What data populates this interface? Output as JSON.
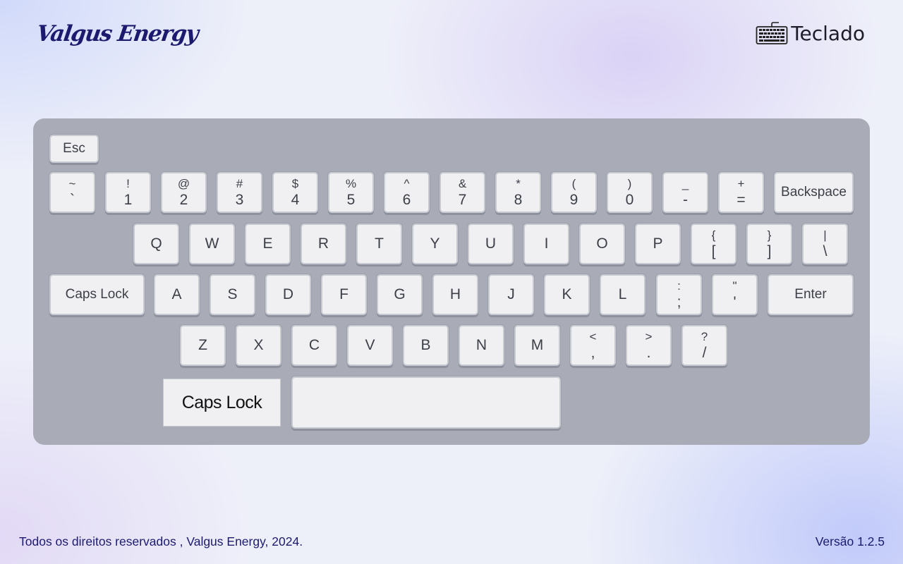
{
  "brand": "Valgus Energy",
  "app_title": "Teclado",
  "icons": {
    "app": "keyboard-icon"
  },
  "keyboard": {
    "esc": "Esc",
    "number_row": [
      {
        "top": "~",
        "bottom": "`"
      },
      {
        "top": "!",
        "bottom": "1"
      },
      {
        "top": "@",
        "bottom": "2"
      },
      {
        "top": "#",
        "bottom": "3"
      },
      {
        "top": "$",
        "bottom": "4"
      },
      {
        "top": "%",
        "bottom": "5"
      },
      {
        "top": "^",
        "bottom": "6"
      },
      {
        "top": "&",
        "bottom": "7"
      },
      {
        "top": "*",
        "bottom": "8"
      },
      {
        "top": "(",
        "bottom": "9"
      },
      {
        "top": ")",
        "bottom": "0"
      },
      {
        "top": "_",
        "bottom": "-"
      },
      {
        "top": "+",
        "bottom": "="
      }
    ],
    "backspace": "Backspace",
    "qwerty_row": [
      "Q",
      "W",
      "E",
      "R",
      "T",
      "Y",
      "U",
      "I",
      "O",
      "P"
    ],
    "qwerty_extra": [
      {
        "top": "{",
        "bottom": "["
      },
      {
        "top": "}",
        "bottom": "]"
      },
      {
        "top": "|",
        "bottom": "\\"
      }
    ],
    "caps_lock": "Caps Lock",
    "home_row": [
      "A",
      "S",
      "D",
      "F",
      "G",
      "H",
      "J",
      "K",
      "L"
    ],
    "home_extra": [
      {
        "top": ":",
        "bottom": ";"
      },
      {
        "top": "\"",
        "bottom": "'"
      }
    ],
    "enter": "Enter",
    "bottom_row": [
      "Z",
      "X",
      "C",
      "V",
      "B",
      "N",
      "M"
    ],
    "bottom_extra": [
      {
        "top": "<",
        "bottom": ","
      },
      {
        "top": ">",
        "bottom": "."
      },
      {
        "top": "?",
        "bottom": "/"
      }
    ],
    "space": ""
  },
  "status": {
    "caps_indicator": "Caps Lock"
  },
  "footer": {
    "copyright": "Todos os direitos reservados , Valgus Energy, 2024.",
    "version": "Versão 1.2.5"
  },
  "colors": {
    "brand": "#1c1a6e",
    "keyboard_bg": "#a9acb6",
    "key_face": "#f0f0f2",
    "key_text": "#3c3f48"
  }
}
